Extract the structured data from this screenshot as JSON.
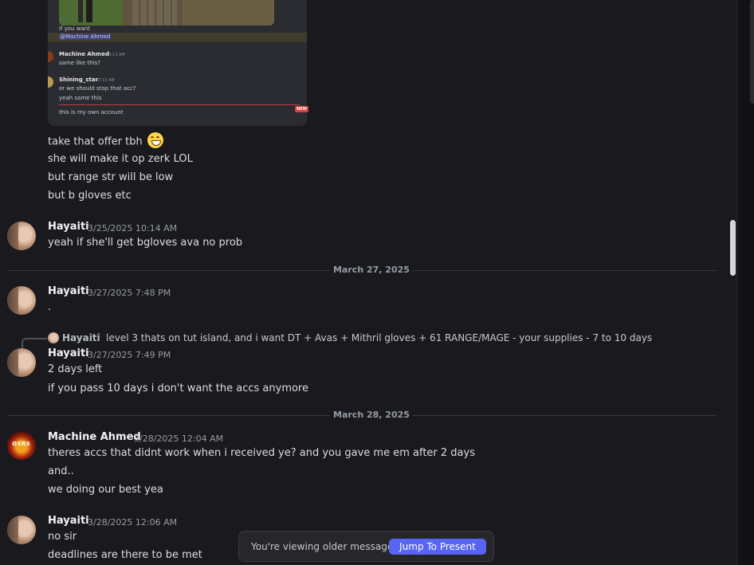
{
  "embed": {
    "line_if_you_want": "if you want",
    "mention": "@Machine Ahmed",
    "msg1_user": "Machine Ahmed",
    "msg1_time": "10:13 AM",
    "msg1_text": "same like this?",
    "msg2_user": "Shining_star",
    "msg2_time": "10:13 AM",
    "msg2_text1": "or we should stop that acc?",
    "msg2_text2": "yeah same  this",
    "new_badge": "NEW",
    "last_line": "this is my own account"
  },
  "continuation": [
    "take that offer tbh",
    "she will make it op zerk LOL",
    "but range str will be low",
    "but b gloves etc"
  ],
  "emoji": "smile-emoji",
  "messages": {
    "m1": {
      "user": "Hayaiti",
      "time": "3/25/2025 10:14 AM",
      "lines": [
        "yeah if she'll get bgloves ava no prob"
      ]
    },
    "m2": {
      "user": "Hayaiti",
      "time": "3/27/2025 7:48 PM",
      "lines": [
        "."
      ]
    },
    "m3": {
      "reply_user": "Hayaiti",
      "reply_text": "level 3 thats on tut island, and i want DT + Avas + Mithril gloves + 61 RANGE/MAGE - your supplies -  7 to 10 days",
      "user": "Hayaiti",
      "time": "3/27/2025 7:49 PM",
      "lines": [
        "2 days left",
        "if you pass 10 days i don't want the accs anymore"
      ]
    },
    "m4": {
      "user": "Machine Ahmed",
      "time": "3/28/2025 12:04 AM",
      "avatar_label": "OSRS",
      "lines": [
        "theres accs that didnt work when i received ye? and you gave me em after 2 days",
        "and..",
        "we doing our best yea"
      ]
    },
    "m5": {
      "user": "Hayaiti",
      "time": "3/28/2025 12:06 AM",
      "lines": [
        "no sir",
        "deadlines are there to be met"
      ]
    }
  },
  "dividers": {
    "d1": "March 27, 2025",
    "d2": "March 28, 2025"
  },
  "older_bar": {
    "text": "You're viewing older messages",
    "button": "Jump To Present"
  },
  "colors": {
    "background": "#1a1a1e",
    "accent": "#5865f2",
    "new_marker": "#d83c3e"
  }
}
